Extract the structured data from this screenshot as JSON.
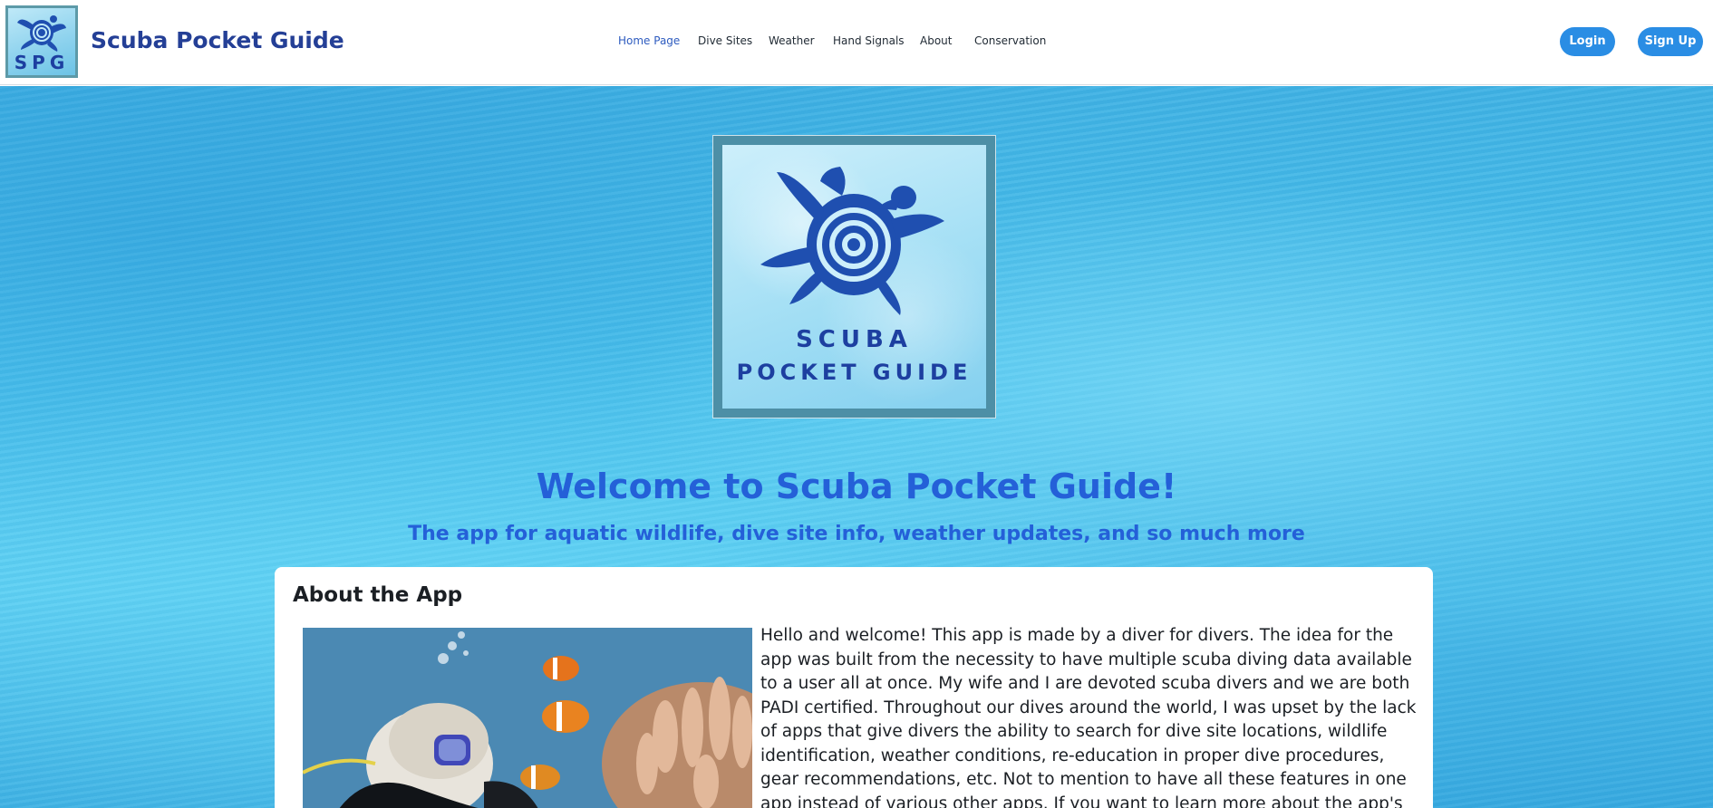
{
  "brand": {
    "logo_text": "SPG",
    "title": "Scuba Pocket Guide"
  },
  "nav": {
    "items": [
      {
        "label": "Home Page",
        "active": true
      },
      {
        "label": "Dive Sites",
        "active": false
      },
      {
        "label": "Weather",
        "active": false
      },
      {
        "label": "Hand Signals",
        "active": false
      },
      {
        "label": "About",
        "active": false
      },
      {
        "label": "Conservation",
        "active": false
      }
    ]
  },
  "auth": {
    "login_label": "Login",
    "signup_label": "Sign Up"
  },
  "hero": {
    "logo_line1": "SCUBA",
    "logo_line2": "POCKET GUIDE",
    "title": "Welcome to Scuba Pocket Guide!",
    "subtitle": "The app for aquatic wildlife, dive site info, weather updates, and so much more"
  },
  "about": {
    "heading": "About the App",
    "body": "Hello and welcome! This app is made by a diver for divers. The idea for the app was built from the necessity to have multiple scuba diving data available to a user all at once. My wife and I are devoted scuba divers and we are both PADI certified. Throughout our dives around the world, I was upset by the lack of apps that give divers the ability to search for dive site locations, wildlife identification, weather conditions, re-education in proper dive procedures, gear recommendations, etc. Not to mention to have all these features in one app instead of various other apps. If you want to learn more about the app's development, myself, or our"
  },
  "colors": {
    "accent": "#2a8de4",
    "brand_blue": "#243f96",
    "heading_blue": "#2460d8",
    "nav_active": "#2d5bbf"
  },
  "icons": {
    "brand_logo": "sea-turtle-icon",
    "hero_logo": "sea-turtle-icon"
  }
}
